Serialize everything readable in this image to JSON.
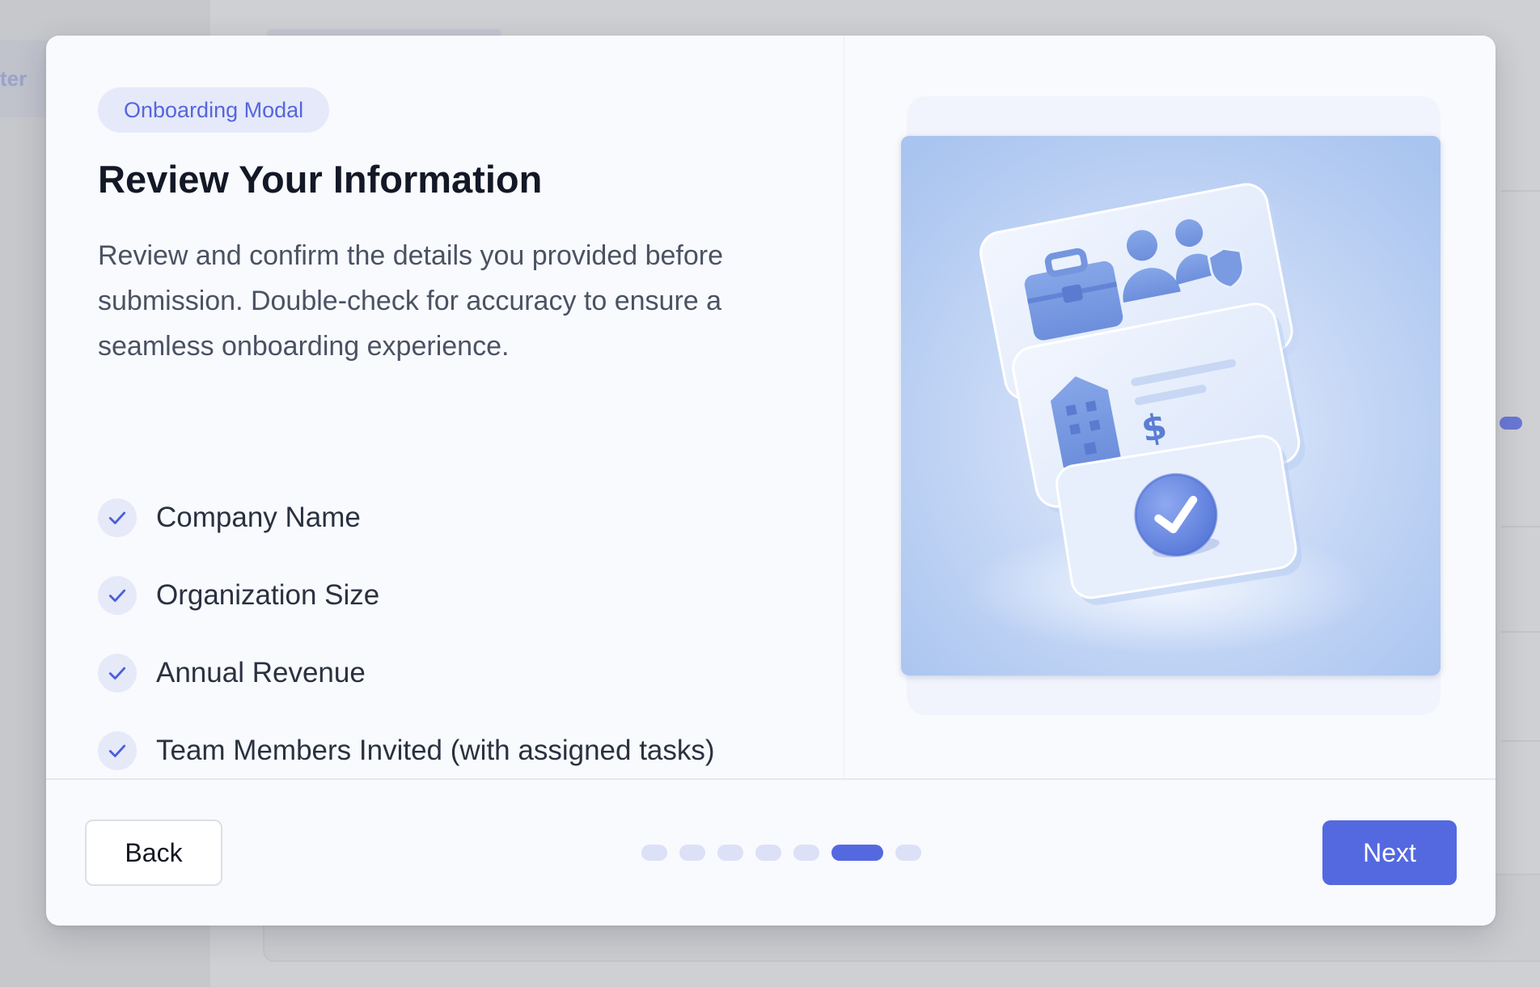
{
  "modal": {
    "badge": "Onboarding Modal",
    "title": "Review Your Information",
    "description": "Review and confirm the details you provided before submission. Double-check for accuracy to ensure a seamless onboarding experience.",
    "checklist": [
      {
        "label": "Company Name",
        "checked": true
      },
      {
        "label": "Organization Size",
        "checked": true
      },
      {
        "label": "Annual Revenue",
        "checked": true
      },
      {
        "label": "Team Members Invited (with assigned tasks)",
        "checked": true
      }
    ],
    "illustration": {
      "icons": [
        "briefcase-icon",
        "users-icon",
        "building-icon",
        "dollar-icon",
        "checkmark-badge-icon"
      ],
      "dollar_symbol": "$"
    }
  },
  "footer": {
    "back_label": "Back",
    "next_label": "Next",
    "progress": {
      "total_steps": 7,
      "current_step": 6
    }
  },
  "background": {
    "sidebar_fragment": "ter"
  },
  "colors": {
    "accent": "#5469e0",
    "badge_bg": "#e5e9fa",
    "badge_text": "#5566dc",
    "check_bg": "#e6e9f8",
    "dot_inactive": "#dce1f8",
    "overlay": "#c9cacd",
    "modal_bg": "#f9fafd"
  }
}
